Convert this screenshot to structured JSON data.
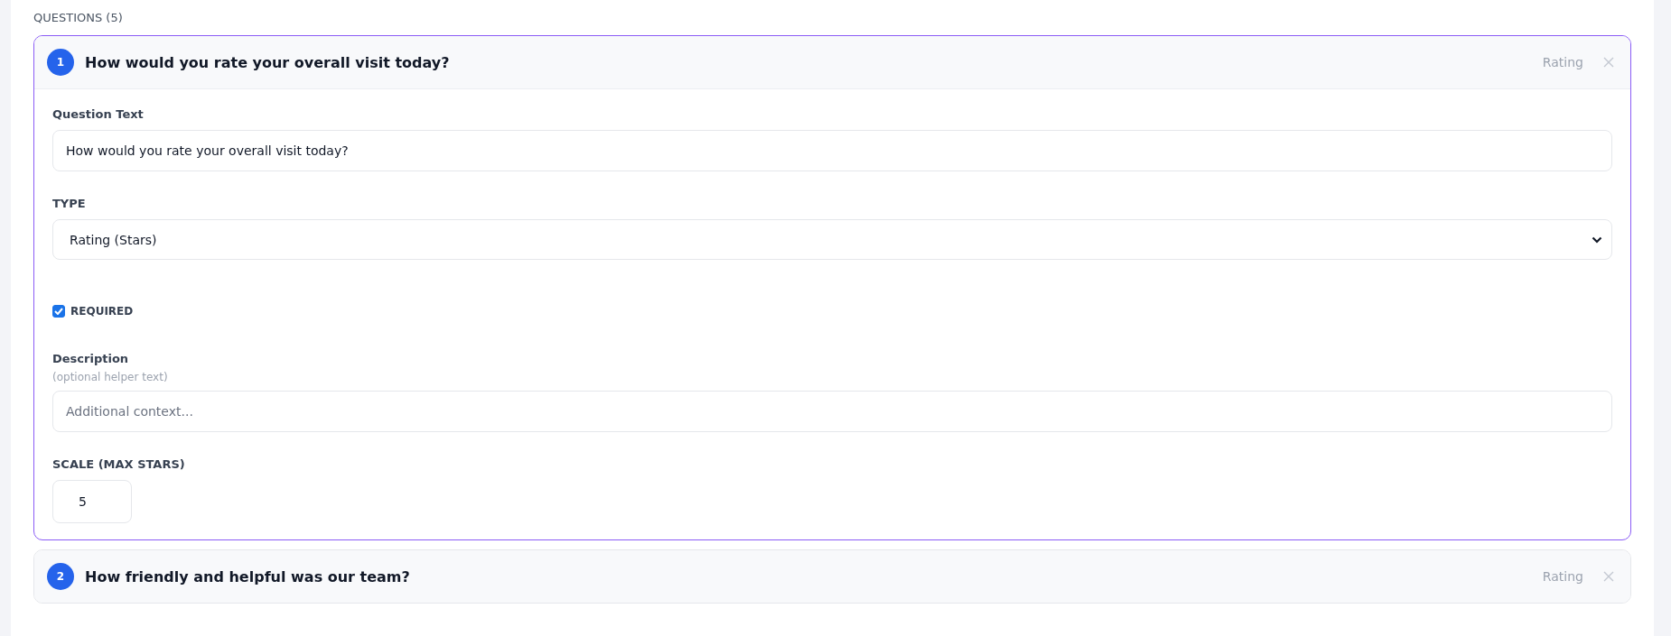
{
  "section_title": "QUESTIONS (5)",
  "questions": [
    {
      "number": "1",
      "title": "How would you rate your overall visit today?",
      "type_label": "Rating",
      "expanded": true,
      "editor": {
        "question_label": "Question Text",
        "question_value": "How would you rate your overall visit today?",
        "type_label": "TYPE",
        "type_value": "Rating (Stars)",
        "required_label": "REQUIRED",
        "required": true,
        "description_label": "Description",
        "description_hint": "(optional helper text)",
        "description_placeholder": "Additional context...",
        "scale_label": "SCALE (MAX STARS)",
        "scale_value": "5"
      }
    },
    {
      "number": "2",
      "title": "How friendly and helpful was our team?",
      "type_label": "Rating",
      "expanded": false
    }
  ]
}
